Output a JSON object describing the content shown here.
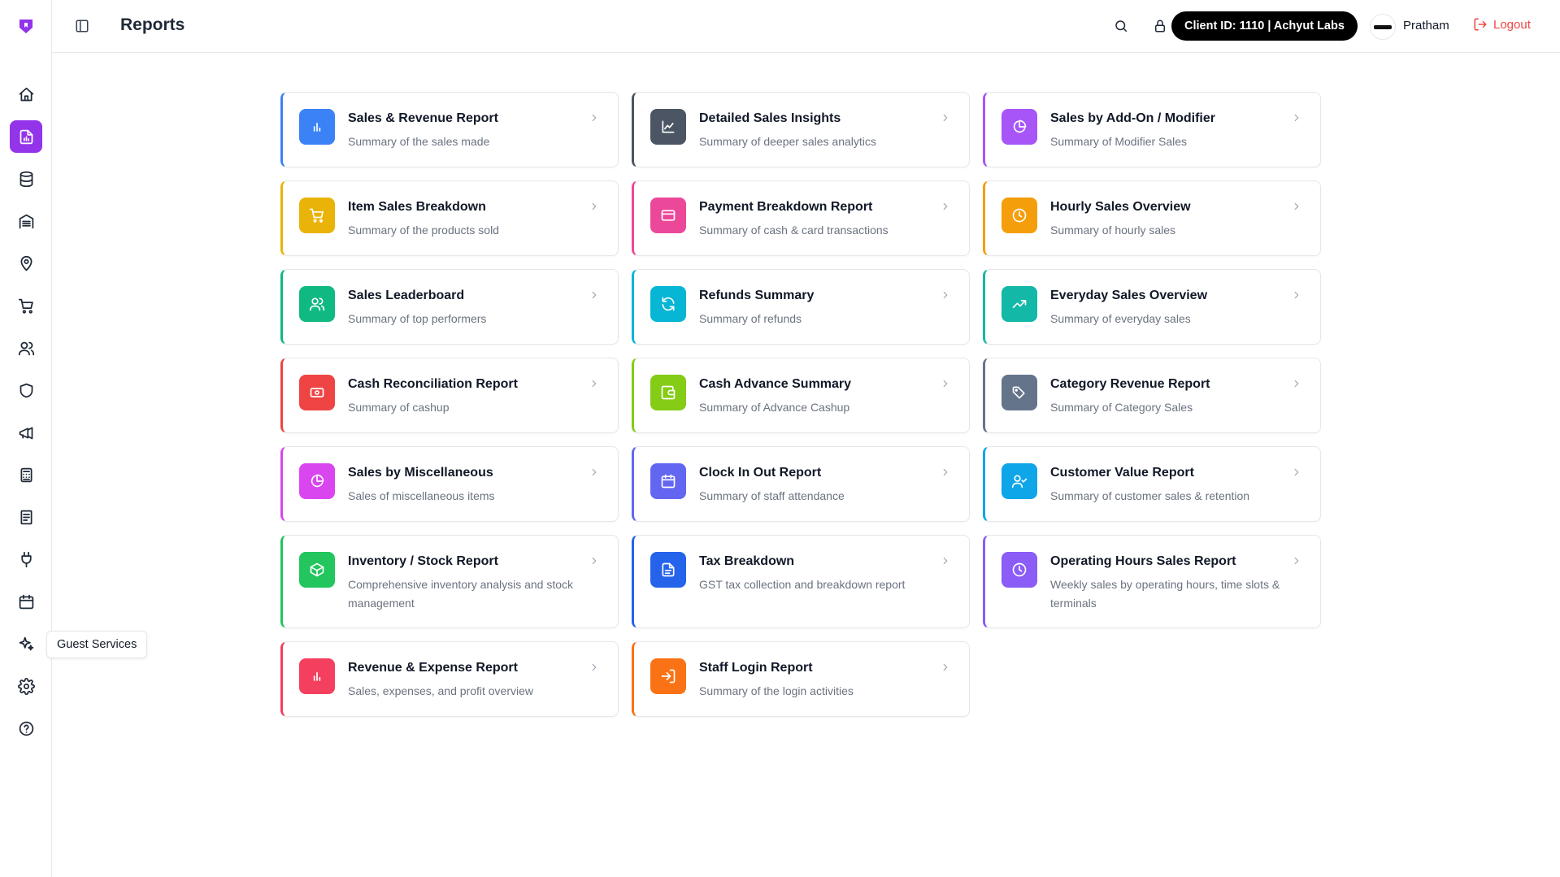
{
  "header": {
    "title": "Reports",
    "client_pill": "Client ID: 1110 | Achyut Labs",
    "user_name": "Pratham",
    "logout_label": "Logout"
  },
  "tooltip": "Guest Services",
  "colors": {
    "accent": "#9333ea",
    "logout": "#ef4444"
  },
  "sidebar": {
    "items": [
      {
        "name": "home",
        "icon": "home-icon",
        "active": false
      },
      {
        "name": "reports",
        "icon": "report-icon",
        "active": true
      },
      {
        "name": "database",
        "icon": "database-icon",
        "active": false
      },
      {
        "name": "warehouse",
        "icon": "warehouse-icon",
        "active": false
      },
      {
        "name": "locations",
        "icon": "map-pin-icon",
        "active": false
      },
      {
        "name": "orders",
        "icon": "cart-icon",
        "active": false
      },
      {
        "name": "users",
        "icon": "users-icon",
        "active": false
      },
      {
        "name": "security",
        "icon": "shield-icon",
        "active": false
      },
      {
        "name": "marketing",
        "icon": "megaphone-icon",
        "active": false
      },
      {
        "name": "calculator",
        "icon": "calculator-icon",
        "active": false
      },
      {
        "name": "documents",
        "icon": "document-icon",
        "active": false
      },
      {
        "name": "integrations",
        "icon": "plug-icon",
        "active": false
      },
      {
        "name": "calendar",
        "icon": "calendar-icon",
        "active": false
      },
      {
        "name": "guest-services",
        "icon": "sparkles-icon",
        "active": false
      },
      {
        "name": "settings",
        "icon": "gear-icon",
        "active": false
      },
      {
        "name": "help",
        "icon": "help-icon",
        "active": false
      }
    ]
  },
  "cards": [
    {
      "title": "Sales & Revenue Report",
      "desc": "Summary of the sales made",
      "color": "#3b82f6",
      "icon": "bar-chart-icon"
    },
    {
      "title": "Detailed Sales Insights",
      "desc": "Summary of deeper sales analytics",
      "color": "#4b5563",
      "icon": "line-chart-icon"
    },
    {
      "title": "Sales by Add-On / Modifier",
      "desc": "Summary of Modifier Sales",
      "color": "#a855f7",
      "icon": "pie-chart-icon"
    },
    {
      "title": "Item Sales Breakdown",
      "desc": "Summary of the products sold",
      "color": "#eab308",
      "icon": "cart-icon"
    },
    {
      "title": "Payment Breakdown Report",
      "desc": "Summary of cash & card transactions",
      "color": "#ec4899",
      "icon": "credit-card-icon"
    },
    {
      "title": "Hourly Sales Overview",
      "desc": "Summary of hourly sales",
      "color": "#f59e0b",
      "icon": "clock-icon"
    },
    {
      "title": "Sales Leaderboard",
      "desc": "Summary of top performers",
      "color": "#10b981",
      "icon": "users-icon"
    },
    {
      "title": "Refunds Summary",
      "desc": "Summary of refunds",
      "color": "#06b6d4",
      "icon": "refresh-icon"
    },
    {
      "title": "Everyday Sales Overview",
      "desc": "Summary of everyday sales",
      "color": "#14b8a6",
      "icon": "trending-up-icon"
    },
    {
      "title": "Cash Reconciliation Report",
      "desc": "Summary of cashup",
      "color": "#ef4444",
      "icon": "banknote-icon"
    },
    {
      "title": "Cash Advance Summary",
      "desc": "Summary of Advance Cashup",
      "color": "#84cc16",
      "icon": "wallet-icon"
    },
    {
      "title": "Category Revenue Report",
      "desc": "Summary of Category Sales",
      "color": "#64748b",
      "icon": "tags-icon"
    },
    {
      "title": "Sales by Miscellaneous",
      "desc": "Sales of miscellaneous items",
      "color": "#d946ef",
      "icon": "pie-chart-icon"
    },
    {
      "title": "Clock In Out Report",
      "desc": "Summary of staff attendance",
      "color": "#6366f1",
      "icon": "calendar-icon"
    },
    {
      "title": "Customer Value Report",
      "desc": "Summary of customer sales & retention",
      "color": "#0ea5e9",
      "icon": "user-check-icon"
    },
    {
      "title": "Inventory / Stock Report",
      "desc": "Comprehensive inventory analysis and stock management",
      "color": "#22c55e",
      "icon": "package-icon"
    },
    {
      "title": "Tax Breakdown",
      "desc": "GST tax collection and breakdown report",
      "color": "#2563eb",
      "icon": "file-text-icon"
    },
    {
      "title": "Operating Hours Sales Report",
      "desc": "Weekly sales by operating hours, time slots & terminals",
      "color": "#8b5cf6",
      "icon": "clock-icon"
    },
    {
      "title": "Revenue & Expense Report",
      "desc": "Sales, expenses, and profit overview",
      "color": "#f43f5e",
      "icon": "bar-chart-icon"
    },
    {
      "title": "Staff Login Report",
      "desc": "Summary of the login activities",
      "color": "#f97316",
      "icon": "login-icon"
    }
  ]
}
